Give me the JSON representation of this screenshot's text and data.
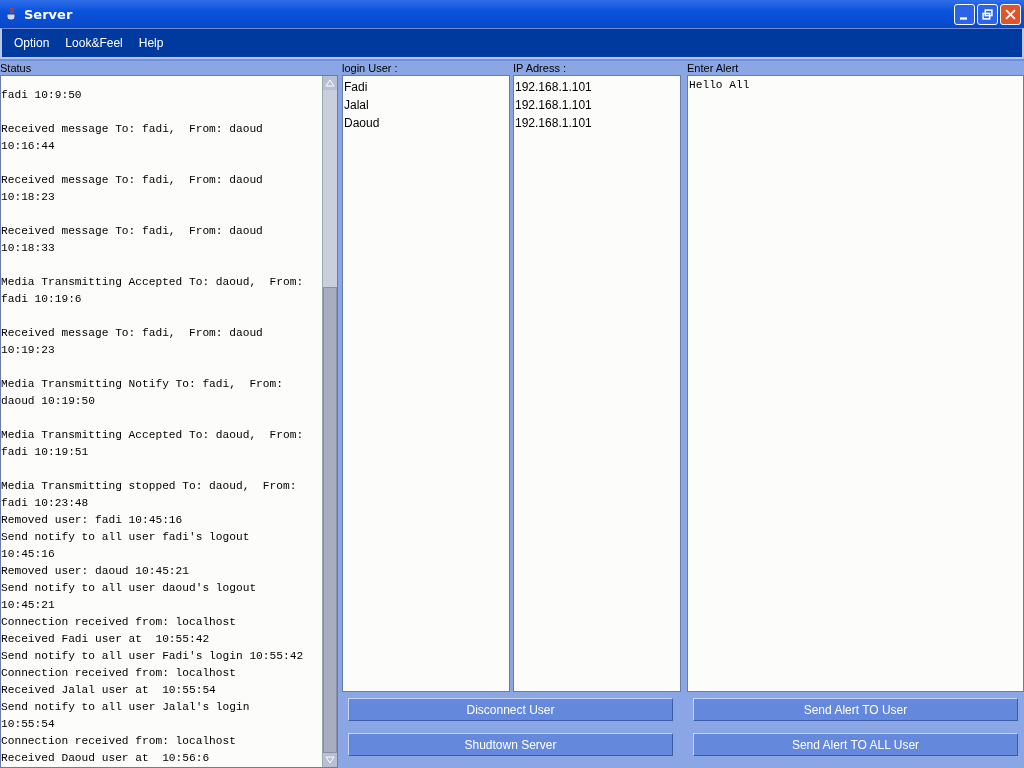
{
  "window": {
    "title": "Server"
  },
  "menu": [
    "Option",
    "Look&Feel",
    "Help"
  ],
  "status": {
    "label": "Status",
    "entries": [
      {
        "lines": [
          "fadi 10:9:50"
        ],
        "spaced": true
      },
      {
        "lines": [
          "Received message To: fadi,  From: daoud",
          "10:16:44"
        ],
        "spaced": true
      },
      {
        "lines": [
          "Received message To: fadi,  From: daoud",
          "10:18:23"
        ],
        "spaced": true
      },
      {
        "lines": [
          "Received message To: fadi,  From: daoud",
          "10:18:33"
        ],
        "spaced": true
      },
      {
        "lines": [
          "Media Transmitting Accepted To: daoud,  From:",
          "fadi 10:19:6"
        ],
        "spaced": true
      },
      {
        "lines": [
          "Received message To: fadi,  From: daoud",
          "10:19:23"
        ],
        "spaced": true
      },
      {
        "lines": [
          "Media Transmitting Notify To: fadi,  From:",
          "daoud 10:19:50"
        ],
        "spaced": true
      },
      {
        "lines": [
          "Media Transmitting Accepted To: daoud,  From:",
          "fadi 10:19:51"
        ],
        "spaced": true
      },
      {
        "lines": [
          "Media Transmitting stopped To: daoud,  From:",
          "fadi 10:23:48"
        ],
        "spaced": false
      },
      {
        "lines": [
          "Removed user: fadi 10:45:16"
        ],
        "spaced": false
      },
      {
        "lines": [
          "Send notify to all user fadi's logout",
          "10:45:16"
        ],
        "spaced": false
      },
      {
        "lines": [
          "Removed user: daoud 10:45:21"
        ],
        "spaced": false
      },
      {
        "lines": [
          "Send notify to all user daoud's logout",
          "10:45:21"
        ],
        "spaced": false
      },
      {
        "lines": [
          "Connection received from: localhost"
        ],
        "spaced": false
      },
      {
        "lines": [
          "Received Fadi user at  10:55:42"
        ],
        "spaced": false
      },
      {
        "lines": [
          "Send notify to all user Fadi's login 10:55:42"
        ],
        "spaced": false
      },
      {
        "lines": [
          "Connection received from: localhost"
        ],
        "spaced": false
      },
      {
        "lines": [
          "Received Jalal user at  10:55:54"
        ],
        "spaced": false
      },
      {
        "lines": [
          "Send notify to all user Jalal's login",
          "10:55:54"
        ],
        "spaced": false
      },
      {
        "lines": [
          "Connection received from: localhost"
        ],
        "spaced": false
      },
      {
        "lines": [
          "Received Daoud user at  10:56:6"
        ],
        "spaced": false
      }
    ]
  },
  "users": {
    "label": "login User :",
    "items": [
      "Fadi",
      "Jalal",
      "Daoud"
    ]
  },
  "ips": {
    "label": "IP Adress :",
    "items": [
      "192.168.1.101",
      "192.168.1.101",
      "192.168.1.101"
    ]
  },
  "alert": {
    "label": "Enter Alert",
    "value": "Hello All"
  },
  "buttons": [
    [
      "Disconnect User",
      "Shudtown Server"
    ],
    [
      "Send Alert TO User",
      "Send Alert TO ALL User"
    ]
  ]
}
